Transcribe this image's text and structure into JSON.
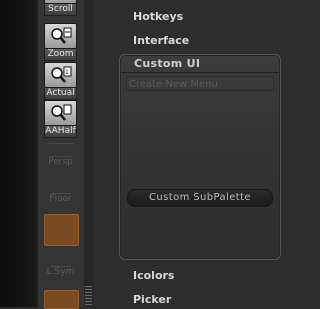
{
  "shelf": {
    "tools": [
      {
        "label": "Scroll"
      },
      {
        "label": "Zoom"
      },
      {
        "label": "Actual"
      },
      {
        "label": "AAHalf"
      },
      {
        "label": "Persp"
      },
      {
        "label": "Floor"
      },
      {
        "label": "L.Sym"
      }
    ]
  },
  "menu": {
    "hotkeys": "Hotkeys",
    "interface": "Interface",
    "icolors": "Icolors",
    "picker": "Picker"
  },
  "custom_ui": {
    "title": "Custom UI",
    "create_menu": "Create New Menu",
    "subpalette": "Custom SubPalette"
  },
  "colors": {
    "accent_orange": "#7a4a20",
    "panel_bg": "#333333"
  }
}
